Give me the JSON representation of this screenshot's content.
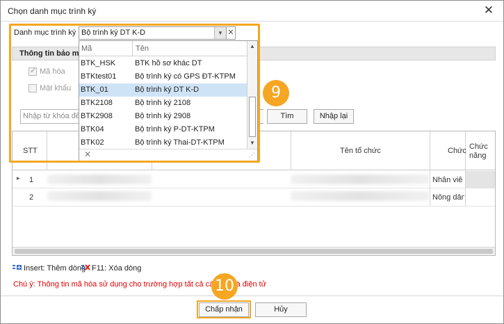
{
  "dialog": {
    "title": "Chọn danh mục trình ký",
    "close_glyph": "✕"
  },
  "combo": {
    "label": "Danh mục trình ký",
    "value": "Bộ trình ký DT K-D",
    "clear_glyph": "✕",
    "arrow_glyph": "▼"
  },
  "popup": {
    "headers": [
      "Mã",
      "Tên"
    ],
    "rows": [
      {
        "code": "BTK_HSK",
        "name": "BTK hồ sơ khác DT"
      },
      {
        "code": "BTKtest01",
        "name": "Bộ trình ký có GPS ĐT-KTPM"
      },
      {
        "code": "BTK_01",
        "name": "Bộ trình ký DT K-D"
      },
      {
        "code": "BTK2108",
        "name": "Bộ trình ký 2108"
      },
      {
        "code": "BTK2908",
        "name": "Bộ trình ký 2908"
      },
      {
        "code": "BTK04",
        "name": "Bộ trình ký P-DT-KTPM"
      },
      {
        "code": "BTK02",
        "name": "Bộ trình ký Thai-DT-KTPM"
      }
    ],
    "selected_index": 2,
    "footer_clear": "✕",
    "grip": "⋰"
  },
  "info": {
    "group_title": "Thông tin bảo m",
    "encrypt_label": "Mã hóa",
    "encrypt_checked": true,
    "password_label": "Mật khẩu",
    "password_checked": false
  },
  "search": {
    "placeholder": "Nhập từ khóa để",
    "find_label": "Tìm",
    "reset_label": "Nhập lại"
  },
  "grid": {
    "headers": {
      "stt": "STT",
      "org": "Tên tổ chức",
      "position": "Chức",
      "function": "Chức năng"
    },
    "rows": [
      {
        "stt": "1",
        "position": "Nhân viê",
        "indicator": "▸"
      },
      {
        "stt": "2",
        "position": "Nông dân"
      }
    ]
  },
  "legend": {
    "insert": "Insert: Thêm dòng",
    "f11": "F11: Xóa dòng"
  },
  "note": "Chú ý: Thông tin mã hóa sử dụng cho trường hợp tất cả các              đều là điện tử",
  "buttons": {
    "accept": "Chấp nhận",
    "cancel": "Hủy"
  },
  "steps": {
    "nine": "9",
    "ten": "10"
  },
  "colors": {
    "highlight": "#f5a623",
    "selected_row": "#cfe3f7",
    "note": "#e00000"
  }
}
